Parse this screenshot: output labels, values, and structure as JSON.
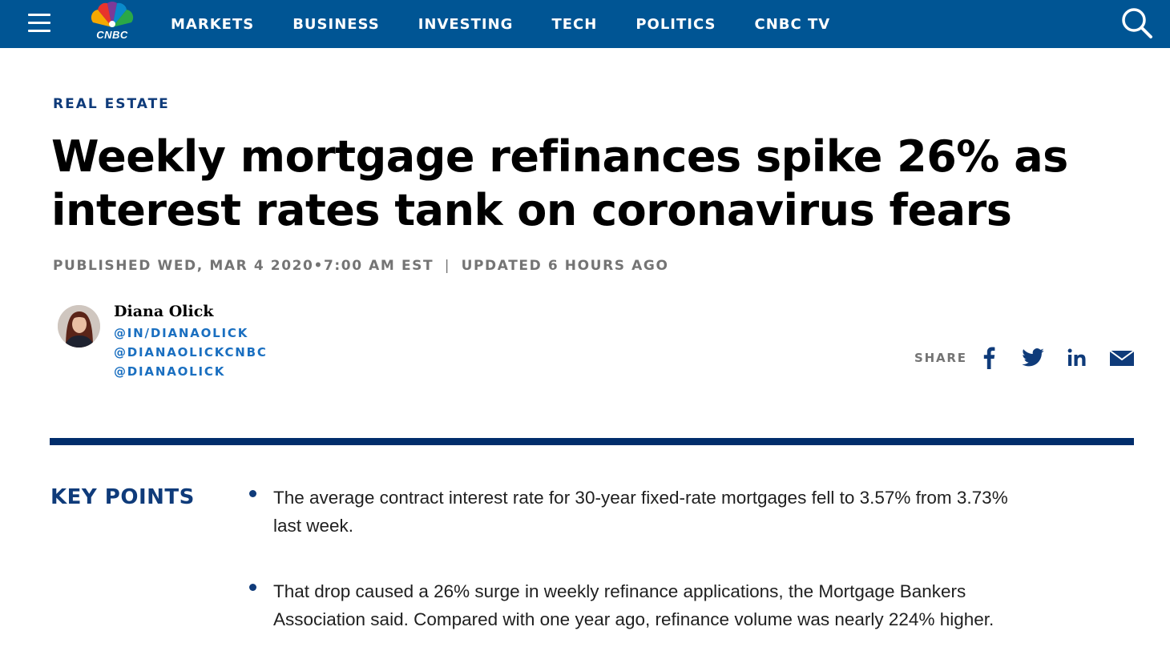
{
  "nav": {
    "logo_text": "CNBC",
    "items": [
      "MARKETS",
      "BUSINESS",
      "INVESTING",
      "TECH",
      "POLITICS",
      "CNBC TV"
    ]
  },
  "article": {
    "section": "REAL ESTATE",
    "headline": "Weekly mortgage refinances spike 26% as interest rates tank on coronavirus fears",
    "published": "PUBLISHED WED, MAR 4 2020•7:00 AM EST",
    "separator": "|",
    "updated": "UPDATED 6 HOURS AGO"
  },
  "author": {
    "name": "Diana Olick",
    "links": [
      "@IN/DIANAOLICK",
      "@DIANAOLICKCNBC",
      "@DIANAOLICK"
    ]
  },
  "share": {
    "label": "SHARE",
    "icons": [
      "facebook-icon",
      "twitter-icon",
      "linkedin-icon",
      "email-icon"
    ]
  },
  "key_points": {
    "title": "KEY POINTS",
    "items": [
      "The average contract interest rate for 30-year fixed-rate mortgages fell to 3.57% from 3.73% last week.",
      "That drop caused a 26% surge in weekly refinance applications, the Mortgage Bankers Association said. Compared with one year ago, refinance volume was nearly 224% higher."
    ]
  },
  "colors": {
    "nav_bg": "#005594",
    "accent_navy": "#0f3b7a",
    "link_blue": "#1a6fc0",
    "divider": "#012d6b",
    "meta_gray": "#747474"
  }
}
